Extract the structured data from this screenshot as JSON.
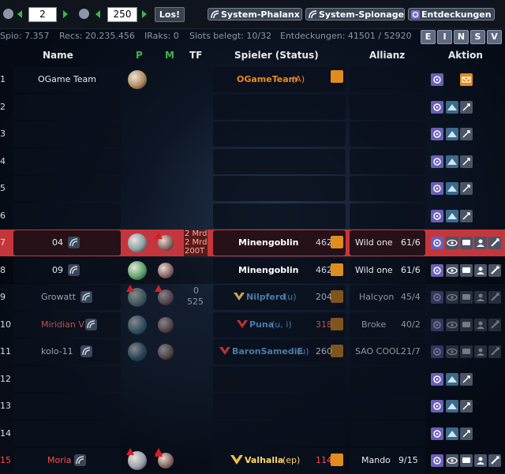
{
  "nav": {
    "galaxy_value": "2",
    "system_value": "250",
    "go_label": "Los!",
    "phalanx_label": "System-Phalanx",
    "spionage_label": "System-Spionage",
    "entdeckungen_label": "Entdeckungen"
  },
  "stats": {
    "spio": "Spio: 7.357",
    "recs": "Recs: 20.235.456",
    "iraks": "IRaks: 0",
    "slots": "Slots belegt: 10/32",
    "entdeckungen": "Entdeckungen: 41501 / 52920",
    "letters": [
      "E",
      "I",
      "N",
      "S",
      "V"
    ]
  },
  "header": {
    "name": "Name",
    "p": "P",
    "m": "M",
    "tf": "TF",
    "spieler": "Spieler (Status)",
    "allianz": "Allianz",
    "aktion": "Aktion"
  },
  "rows": [
    {
      "pos": "1",
      "name": "OGame Team",
      "player": "OGameTeam",
      "status": "(A)",
      "rank": "",
      "ally": "",
      "ally_members": ""
    },
    {
      "pos": "2",
      "name": "",
      "player": "",
      "status": "",
      "rank": "",
      "ally": "",
      "ally_members": ""
    },
    {
      "pos": "3",
      "name": "",
      "player": "",
      "status": "",
      "rank": "",
      "ally": "",
      "ally_members": ""
    },
    {
      "pos": "4",
      "name": "",
      "player": "",
      "status": "",
      "rank": "",
      "ally": "",
      "ally_members": ""
    },
    {
      "pos": "5",
      "name": "",
      "player": "",
      "status": "",
      "rank": "",
      "ally": "",
      "ally_members": ""
    },
    {
      "pos": "6",
      "name": "",
      "player": "",
      "status": "",
      "rank": "",
      "ally": "",
      "ally_members": ""
    },
    {
      "pos": "7",
      "name": "04",
      "player": "Minengoblin",
      "status": "",
      "rank": "462",
      "ally": "Wild one",
      "ally_members": "61/6",
      "tf_lines": [
        "2 Mrd",
        "2 Mrd",
        "200T"
      ]
    },
    {
      "pos": "8",
      "name": "09",
      "player": "Minengoblin",
      "status": "",
      "rank": "462",
      "ally": "Wild one",
      "ally_members": "61/6"
    },
    {
      "pos": "9",
      "name": "Growatt",
      "player": "Nilpferd",
      "status": "(u)",
      "rank": "204",
      "ally": "Halcyon",
      "ally_members": "45/4",
      "tf_lines": [
        "0",
        "525"
      ]
    },
    {
      "pos": "10",
      "name": "Miridian VI",
      "player": "Puna",
      "status": "(u, i)",
      "rank": "318",
      "ally": "Broke",
      "ally_members": "40/2"
    },
    {
      "pos": "11",
      "name": "kolo-11",
      "player": "BaronSamediE",
      "status": "(u)",
      "rank": "260",
      "ally": "SAO COOL",
      "ally_members": "21/7"
    },
    {
      "pos": "12",
      "name": "",
      "player": "",
      "status": "",
      "rank": "",
      "ally": "",
      "ally_members": ""
    },
    {
      "pos": "13",
      "name": "",
      "player": "",
      "status": "",
      "rank": "",
      "ally": "",
      "ally_members": ""
    },
    {
      "pos": "14",
      "name": "",
      "player": "",
      "status": "",
      "rank": "",
      "ally": "",
      "ally_members": ""
    },
    {
      "pos": "15",
      "name": "Moria",
      "player": "Valhalla",
      "status": "(ep)",
      "rank": "114",
      "ally": "Mando",
      "ally_members": "9/15"
    }
  ],
  "colors": {
    "highlight_row": "#c5363c",
    "admin_orange": "#f08a1a",
    "inactive_red": "#b33b3b",
    "vacation_blue": "#5a9fd6"
  }
}
